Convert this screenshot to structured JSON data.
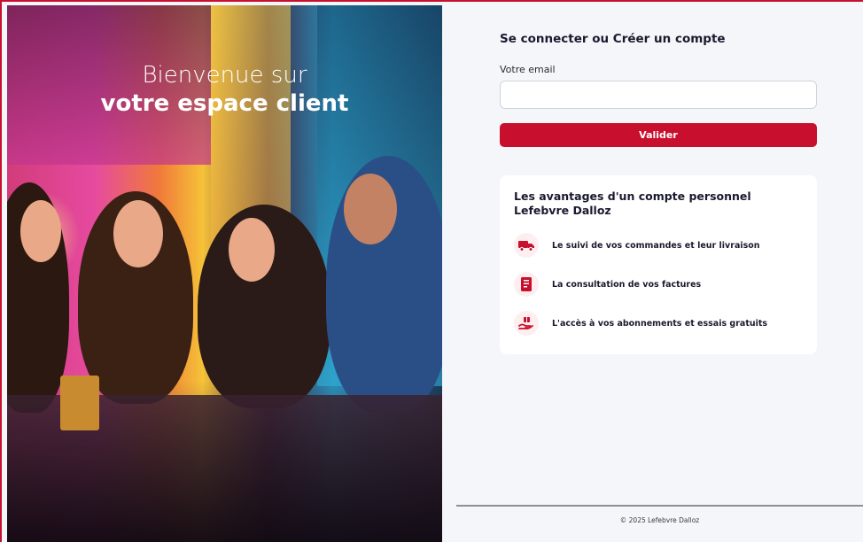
{
  "hero": {
    "welcome_line1": "Bienvenue sur",
    "welcome_line2": "votre espace client"
  },
  "login": {
    "title": "Se connecter ou Créer un compte",
    "email_label": "Votre email",
    "email_value": "",
    "email_placeholder": "",
    "submit_label": "Valider"
  },
  "advantages": {
    "title": "Les avantages d'un compte personnel Lefebvre Dalloz",
    "items": [
      {
        "icon": "delivery-truck-icon",
        "label": "Le suivi de vos commandes et leur livraison"
      },
      {
        "icon": "invoice-icon",
        "label": "La consultation de vos factures"
      },
      {
        "icon": "gift-hand-icon",
        "label": "L'accès à vos abonnements et essais gratuits"
      }
    ]
  },
  "footer": {
    "copyright": "© 2025 Lefebvre Dalloz"
  },
  "colors": {
    "brand": "#c8102e",
    "background": "#f4f6f9",
    "card": "#ffffff"
  }
}
